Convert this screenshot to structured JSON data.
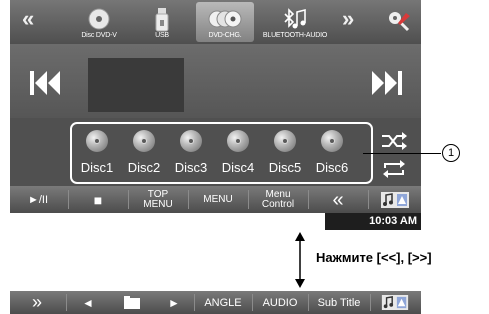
{
  "top_bar": {
    "prev_scroll": "«",
    "sources": [
      {
        "label": "Disc DVD-V",
        "icon": "disc-icon"
      },
      {
        "label": "USB",
        "icon": "usb-icon"
      },
      {
        "label": "DVD-CHG.",
        "icon": "disc-changer-icon"
      },
      {
        "label": "BLUETOOTH-AUDIO",
        "icon": "bluetooth-audio-icon"
      }
    ],
    "next_scroll": "»",
    "active_source": "DVD-CHG."
  },
  "player": {
    "prev_icon": "previous-track-icon",
    "next_icon": "next-track-icon"
  },
  "discs": [
    "Disc1",
    "Disc2",
    "Disc3",
    "Disc4",
    "Disc5",
    "Disc6"
  ],
  "side_controls": {
    "shuffle_icon": "shuffle-icon",
    "repeat_icon": "repeat-icon"
  },
  "bottom_bar": {
    "play_pause": "►/II",
    "stop": "■",
    "top_menu": "TOP MENU",
    "menu": "MENU",
    "menu_control": "Menu Control",
    "back": "«"
  },
  "time": "10:03 AM",
  "callout_number": "1",
  "instruction": "Нажмите [<<], [>>]",
  "alt_bar": {
    "forward": "»",
    "prev": "◄",
    "play": "►",
    "angle": "ANGLE",
    "audio": "AUDIO",
    "subtitle": "Sub Title"
  },
  "colors": {
    "screen_bg": "#5c5c5c",
    "bar_text": "#ffffff",
    "frame": "#ffffff"
  }
}
